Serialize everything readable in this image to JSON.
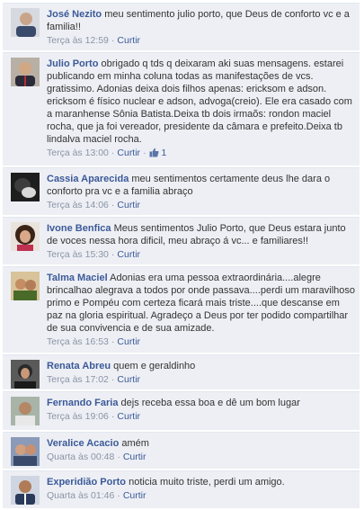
{
  "comments": [
    {
      "author": "José Nezito",
      "text": "meu sentimento julio porto, que Deus de conforto vc e a familia!!",
      "time": "Terça às 12:59",
      "like_label": "Curtir",
      "avatar_color": "#b9bfc9"
    },
    {
      "author": "Julio Porto",
      "text": "obrigado q tds q deixaram aki suas mensagens. estarei publicando em minha coluna todas as manifestações de vcs. gratissimo. Adonias deixa dois filhos apenas: ericksom e adson. ericksom é físico nuclear e adson, advoga(creio). Ele era casado com a maranhense Sônia Batista.Deixa tb dois irmaõs: rondon maciel rocha, que ja foi vereador, presidente da câmara e prefeito.Deixa tb lindalva maciel rocha.",
      "time": "Terça às 13:00",
      "like_label": "Curtir",
      "like_count": "1",
      "avatar_color": "#7a6a5a"
    },
    {
      "author": "Cassia Aparecida",
      "text": "meu sentimentos certamente deus lhe dara o conforto pra vc e a familia abraço",
      "time": "Terça às 14:06",
      "like_label": "Curtir",
      "avatar_color": "#2b2b2b"
    },
    {
      "author": "Ivone Benfica",
      "text": "Meus sentimentos Julio Porto, que Deus estara junto de voces nessa hora dificil, meu abraço á vc... e familiares!!",
      "time": "Terça às 15:30",
      "like_label": "Curtir",
      "avatar_color": "#5a3a2a"
    },
    {
      "author": "Talma Maciel",
      "text": "Adonias era uma pessoa extraordinária....alegre brincalhao alegrava a todos por onde passava....perdi um maravilhoso primo e Pompéu com certeza ficará mais triste....que descanse em paz na gloria espiritual. Agradeço a Deus por ter podido compartilhar de sua convivencia e de sua amizade.",
      "time": "Terça às 16:53",
      "like_label": "Curtir",
      "avatar_color": "#a07a4a"
    },
    {
      "author": "Renata Abreu",
      "text": "quem e geraldinho",
      "time": "Terça às 17:02",
      "like_label": "Curtir",
      "avatar_color": "#3a3a3a"
    },
    {
      "author": "Fernando Faria",
      "text": "dejs receba essa boa e dê um bom lugar",
      "time": "Terça às 19:06",
      "like_label": "Curtir",
      "avatar_color": "#6a7a6a"
    },
    {
      "author": "Veralice Acacio",
      "text": "amém",
      "time": "Quarta às 00:48",
      "like_label": "Curtir",
      "avatar_color": "#4a5a7a"
    },
    {
      "author": "Experidião Porto",
      "text": "noticia muito triste, perdi um amigo.",
      "time": "Quarta às 01:46",
      "like_label": "Curtir",
      "avatar_color": "#7a5a3a"
    }
  ]
}
